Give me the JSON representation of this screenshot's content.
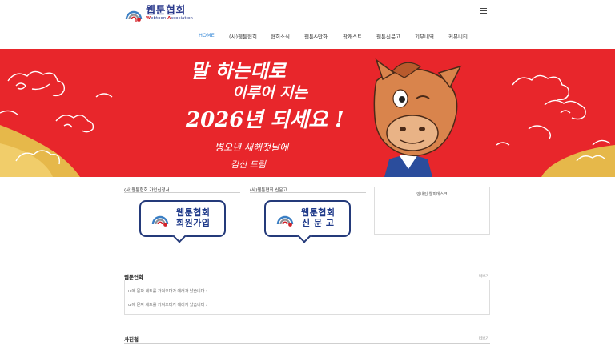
{
  "header": {
    "logo_title": "웹툰협회",
    "logo_sub_first": "W",
    "logo_sub_mid": "ebtoon ",
    "logo_sub_second": "A",
    "logo_sub_rest": "ssociation"
  },
  "nav": {
    "items": [
      "HOME",
      "(사)웹툰협회",
      "협회소식",
      "웹툰&만화",
      "팟캐스트",
      "웹툰신문고",
      "기부내역",
      "커뮤니티"
    ]
  },
  "banner": {
    "line1": "말 하는대로",
    "line2": "이루어 지는",
    "line3": "2026년 되세요 !",
    "line4": "병오년 새해첫날에",
    "line5": "김신 드림"
  },
  "join": {
    "label": "(사)웹툰협회 가입신청서",
    "button_line1": "웹툰협회",
    "button_line2": "회원가입"
  },
  "report": {
    "label": "(사)웹툰협회 신문고",
    "button_line1": "웹툰협회",
    "button_line2": "신 문 고"
  },
  "side": {
    "title": "안내인 웹피데스크"
  },
  "webtoon_talk": {
    "title": "웹툰연화",
    "more": "더보기",
    "lines": [
      "ui에 문자 세트를 가져오다가 에러가 났습니다 :",
      "ui에 문자 세트를 가져오다가 에러가 났습니다 :"
    ]
  },
  "gallery": {
    "title": "사진첩",
    "more": "더보기"
  },
  "colors": {
    "banner_red": "#e8262b",
    "nav_active": "#3a8bd8",
    "brand_navy": "#243a7a"
  }
}
